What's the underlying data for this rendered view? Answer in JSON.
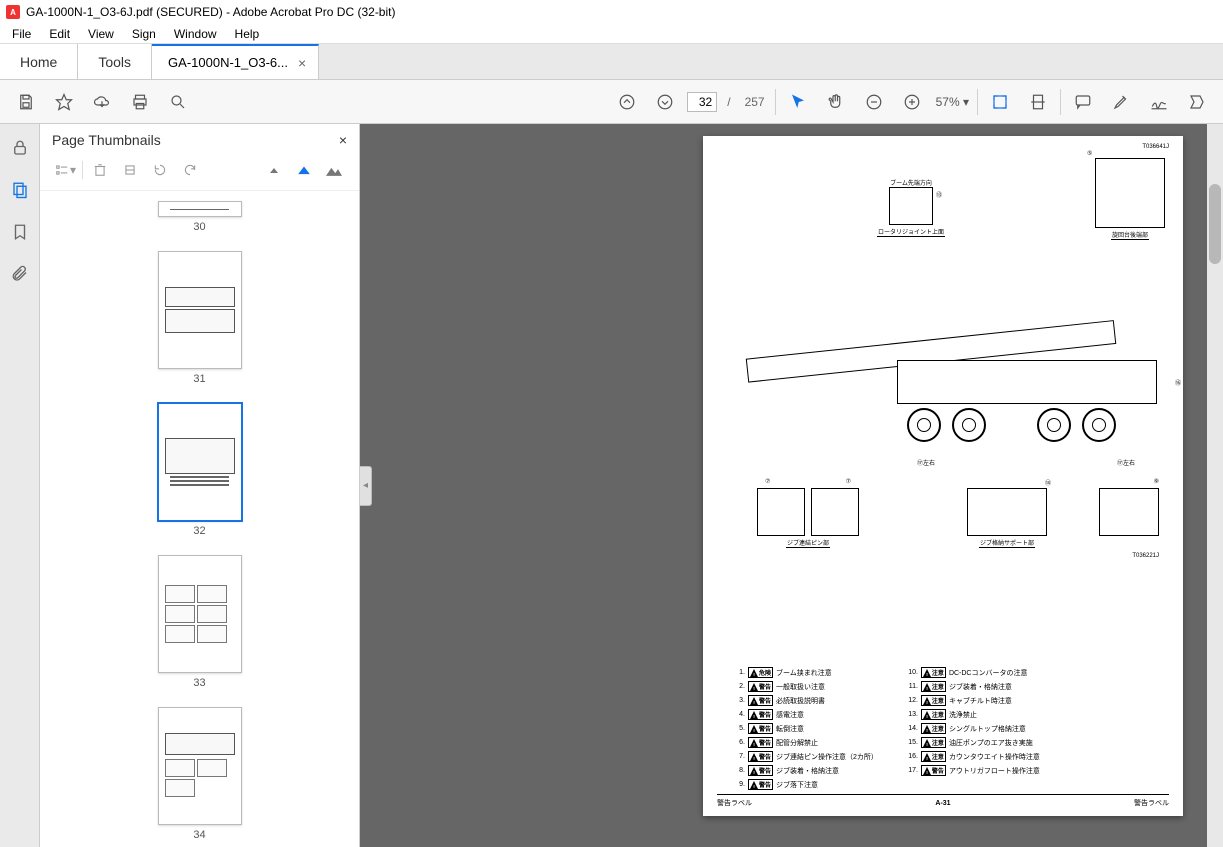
{
  "window": {
    "title": "GA-1000N-1_O3-6J.pdf (SECURED) - Adobe Acrobat Pro DC (32-bit)"
  },
  "menu": {
    "file": "File",
    "edit": "Edit",
    "view": "View",
    "sign": "Sign",
    "window": "Window",
    "help": "Help"
  },
  "tabs": {
    "home": "Home",
    "tools": "Tools",
    "doc": "GA-1000N-1_O3-6..."
  },
  "toolbar": {
    "page_current": "32",
    "page_sep": "/",
    "page_total": "257",
    "zoom": "57%"
  },
  "thumbnails": {
    "title": "Page Thumbnails",
    "pages": {
      "p30": "30",
      "p31": "31",
      "p32": "32",
      "p33": "33",
      "p34": "34"
    }
  },
  "document": {
    "code_top": "T036641J",
    "code_mid": "T036221J",
    "callouts": {
      "boom_dir": "ブーム先端方向",
      "rotary": "ロータリジョイント上面",
      "rear": "旋回台後端部",
      "jib_pin": "ジブ連結ピン部",
      "jib_support": "ジブ格納サポート部",
      "lr1": "⑰左右",
      "lr2": "⑰左右",
      "num5": "⑤",
      "num9": "⑨",
      "num13": "⑬",
      "num14": "⑭",
      "num16": "⑯",
      "num7a": "⑦",
      "num7b": "⑦"
    },
    "warnings_left": [
      {
        "n": "1.",
        "type": "危険",
        "text": "ブーム挟まれ注意"
      },
      {
        "n": "2.",
        "type": "警告",
        "text": "一般取扱い注意"
      },
      {
        "n": "3.",
        "type": "警告",
        "text": "必読取扱説明書"
      },
      {
        "n": "4.",
        "type": "警告",
        "text": "感電注意"
      },
      {
        "n": "5.",
        "type": "警告",
        "text": "転倒注意"
      },
      {
        "n": "6.",
        "type": "警告",
        "text": "配管分解禁止"
      },
      {
        "n": "7.",
        "type": "警告",
        "text": "ジブ連結ピン操作注意（2カ所）"
      },
      {
        "n": "8.",
        "type": "警告",
        "text": "ジブ装着・格納注意"
      },
      {
        "n": "9.",
        "type": "警告",
        "text": "ジブ落下注意"
      }
    ],
    "warnings_right": [
      {
        "n": "10.",
        "type": "注意",
        "text": "DC-DCコンバータの注意"
      },
      {
        "n": "11.",
        "type": "注意",
        "text": "ジブ装着・格納注意"
      },
      {
        "n": "12.",
        "type": "注意",
        "text": "キャブチルト時注意"
      },
      {
        "n": "13.",
        "type": "注意",
        "text": "洗浄禁止"
      },
      {
        "n": "14.",
        "type": "注意",
        "text": "シングルトップ格納注意"
      },
      {
        "n": "15.",
        "type": "注意",
        "text": "油圧ポンプのエア抜き実施"
      },
      {
        "n": "16.",
        "type": "注意",
        "text": "カウンタウエイト操作時注意"
      },
      {
        "n": "17.",
        "type": "警告",
        "text": "アウトリガフロート操作注意"
      }
    ],
    "footer": {
      "left": "警告ラベル",
      "center": "A-31",
      "right": "警告ラベル"
    }
  }
}
